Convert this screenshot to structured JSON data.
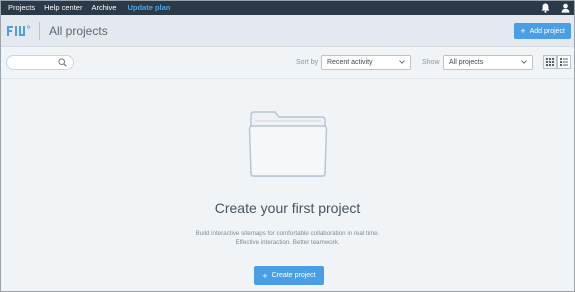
{
  "topnav": {
    "items": [
      "Projects",
      "Help center",
      "Archive"
    ],
    "upgrade_label": "Update plan",
    "icons": [
      "bell-icon",
      "user-icon"
    ]
  },
  "header": {
    "logo_icon": "flowmapp-logo-icon",
    "title": "All projects",
    "add_project_label": "Add project"
  },
  "toolbar": {
    "search_placeholder": "",
    "sort_label": "Sort by",
    "sort_value": "Recent activity",
    "show_label": "Show",
    "show_value": "All projects",
    "view_modes": [
      "grid-view-icon",
      "list-view-icon"
    ]
  },
  "empty_state": {
    "icon": "folder-icon",
    "title": "Create your first project",
    "description_line1": "Build interactive sitemaps for comfortable collaboration in real time.",
    "description_line2": "Effective interaction. Better teamwork.",
    "create_label": "Create project"
  },
  "colors": {
    "topnav_bg": "#2b3a49",
    "accent": "#4a9ee6",
    "upgrade_link": "#4fa3e8",
    "page_bg": "#f1f4f7"
  }
}
